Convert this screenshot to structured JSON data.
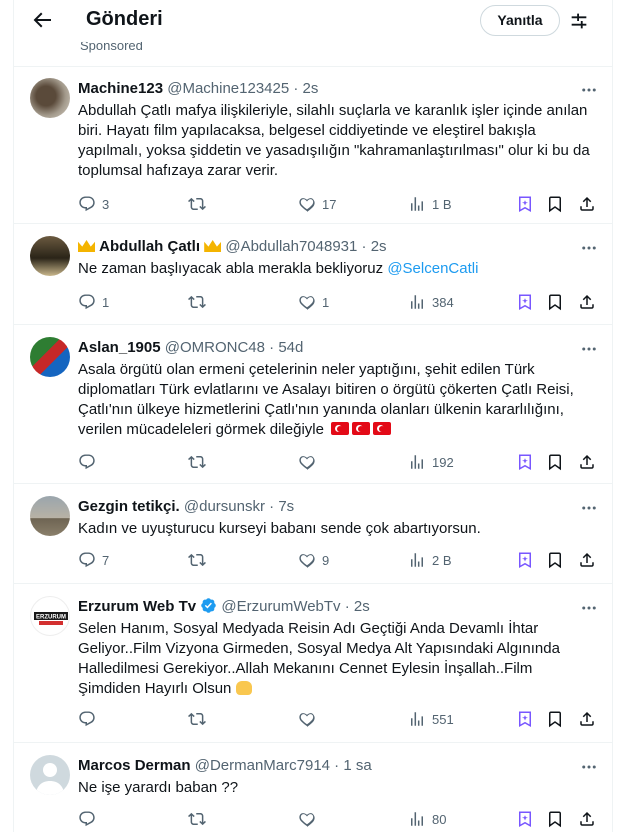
{
  "header": {
    "title": "Gönderi",
    "reply_button": "Yanıtla",
    "sponsored": "Sponsored"
  },
  "tweets": [
    {
      "name": "Machine123",
      "handle": "@Machine123425",
      "dot": "·",
      "time": "2s",
      "text": "Abdullah Çatlı mafya ilişkileriyle, silahlı suçlarla ve karanlık işler içinde anılan biri. Hayatı film yapılacaksa, belgesel ciddiyetinde ve eleştirel bakışla yapılmalı, yoksa şiddetin ve yasadışılığın \"kahramanlaştırılması\" olur ki bu da toplumsal hafızaya zarar verir.",
      "replies": "3",
      "retweets": "",
      "likes": "17",
      "views": "1 B"
    },
    {
      "name": "Abdullah Çatlı",
      "handle": "@Abdullah7048931",
      "dot": "·",
      "time": "2s",
      "text": "Ne zaman başlıyacak abla merakla bekliyoruz",
      "mention": "@SelcenCatli",
      "replies": "1",
      "retweets": "",
      "likes": "1",
      "views": "384"
    },
    {
      "name": "Aslan_1905",
      "handle": "@OMRONC48",
      "dot": "·",
      "time": "54d",
      "text": "Asala örgütü olan ermeni çetelerinin neler yaptığını, şehit edilen Türk diplomatları Türk evlatlarını ve Asalayı bitiren o örgütü çökerten Çatlı Reisi, Çatlı'nın ülkeye hizmetlerini Çatlı'nın yanında olanları ülkenin kararlılığını, verilen mücadeleleri görmek dileğiyle",
      "replies": "",
      "retweets": "",
      "likes": "",
      "views": "192"
    },
    {
      "name": "Gezgin tetikçi.",
      "handle": "@dursunskr",
      "dot": "·",
      "time": "7s",
      "text": "Kadın ve uyuşturucu kurseyi babanı sende çok abartıyorsun.",
      "replies": "7",
      "retweets": "",
      "likes": "9",
      "views": "2 B"
    },
    {
      "name": "Erzurum Web Tv",
      "handle": "@ErzurumWebTv",
      "dot": "·",
      "time": "2s",
      "avatar_text": "ERZURUM",
      "text": "Selen Hanım, Sosyal Medyada Reisin Adı Geçtiği Anda Devamlı İhtar Geliyor..Film Vizyona Girmeden, Sosyal Medya Alt Yapısındaki Algınında Halledilmesi Gerekiyor..Allah Mekanını Cennet Eylesin İnşallah..Film Şimdiden Hayırlı Olsun",
      "replies": "",
      "retweets": "",
      "likes": "",
      "views": "551"
    },
    {
      "name": "Marcos Derman",
      "handle": "@DermanMarc7914",
      "dot": "·",
      "time": "1 sa",
      "text": "Ne işe yarardı baban ??",
      "replies": "",
      "retweets": "",
      "likes": "",
      "views": "80"
    }
  ],
  "colors": {
    "text": "#0f1419",
    "secondary": "#536471",
    "link": "#1d9bf0",
    "border": "#eff3f4",
    "grok_icon": "#7856ff"
  },
  "icons": [
    "back-arrow-icon",
    "filter-icon",
    "more-icon",
    "reply-icon",
    "retweet-icon",
    "like-icon",
    "views-icon",
    "grok-icon",
    "bookmark-icon",
    "share-icon",
    "verified-icon",
    "crown-icon",
    "turkish-flag-icon"
  ]
}
